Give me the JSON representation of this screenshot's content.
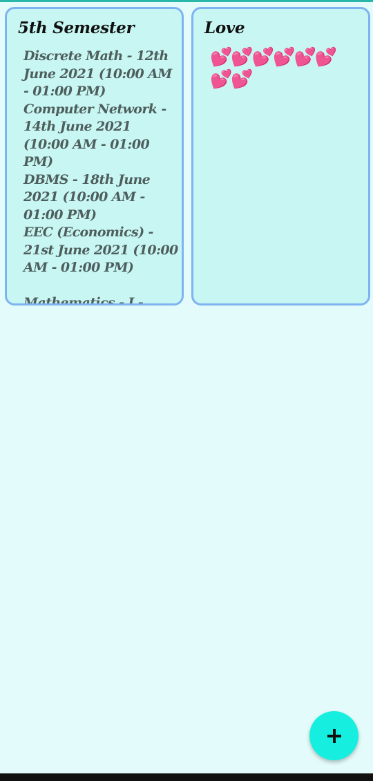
{
  "colors": {
    "background": "#e3fbfa",
    "card_background": "#c8f7f3",
    "card_border": "#7eb3f2",
    "fab": "#16eee0",
    "heart": "#e58fc0"
  },
  "notes": [
    {
      "title": "5th Semester",
      "body": "Discrete Math - 12th June 2021 (10:00 AM - 01:00 PM)\nComputer Network - 14th June 2021 (10:00 AM - 01:00 PM)\nDBMS - 18th June 2021 (10:00 AM - 01:00 PM)\nEEC (Economics) - 21st June 2021 (10:00 AM - 01:00 PM)\n\nMathematics - I -"
    },
    {
      "title": "Love",
      "body": "💕💕💕💕💕💕💕💕"
    }
  ],
  "fab": {
    "icon": "plus-icon"
  }
}
